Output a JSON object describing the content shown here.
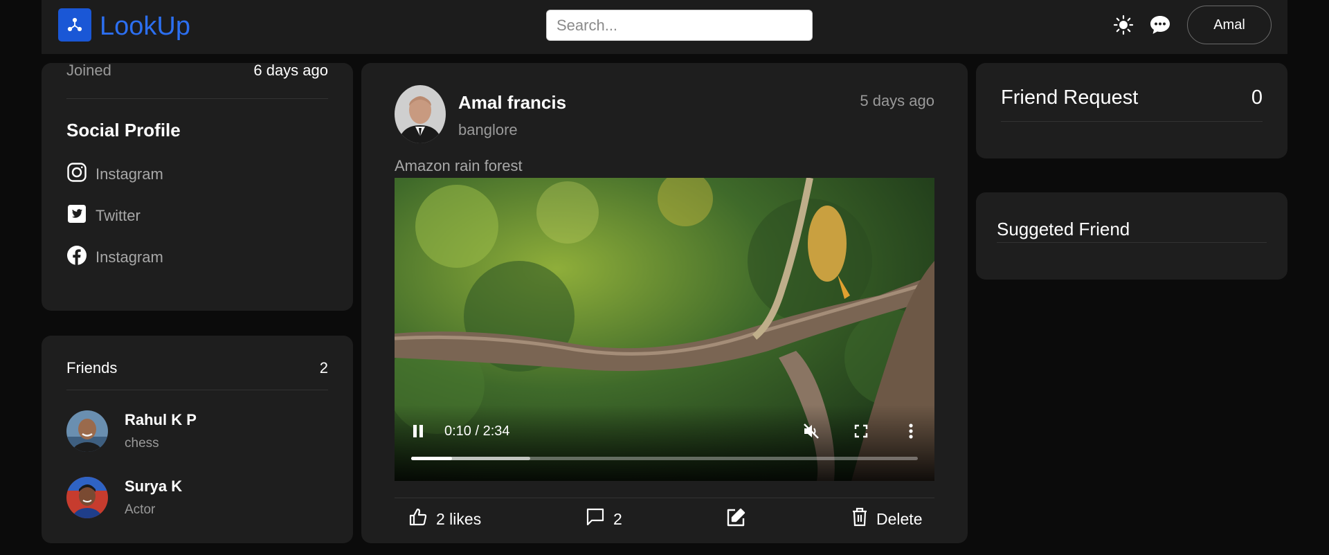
{
  "navbar": {
    "brand": "LookUp",
    "search_placeholder": "Search...",
    "user_label": "Amal"
  },
  "profile": {
    "joined_label": "Joined",
    "joined_value": "6 days ago",
    "social_title": "Social Profile",
    "social_links": [
      {
        "label": "Instagram",
        "icon": "instagram-icon"
      },
      {
        "label": "Twitter",
        "icon": "twitter-icon"
      },
      {
        "label": "Instagram",
        "icon": "facebook-icon"
      }
    ]
  },
  "friends": {
    "title": "Friends",
    "count": "2",
    "items": [
      {
        "name": "Rahul K P",
        "sub": "chess"
      },
      {
        "name": "Surya K",
        "sub": "Actor"
      }
    ]
  },
  "post": {
    "author": "Amal francis",
    "location": "banglore",
    "time": "5 days ago",
    "caption": "Amazon rain forest",
    "video": {
      "time_display": "0:10 / 2:34",
      "progress": 0.08,
      "buffered": 0.235
    },
    "actions": {
      "likes": "2 likes",
      "comments": "2",
      "delete": "Delete"
    }
  },
  "friend_request": {
    "title": "Friend Request",
    "count": "0"
  },
  "suggested": {
    "title": "Suggeted Friend"
  },
  "colors": {
    "accent": "#1a57d6",
    "background": "#0b0b0b",
    "card": "#1e1e1e"
  }
}
